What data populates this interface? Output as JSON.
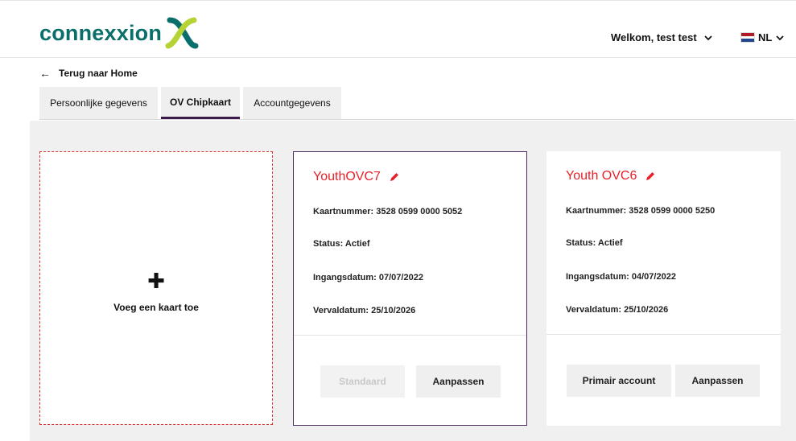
{
  "header": {
    "logo_text": "connexxion",
    "welcome": "Welkom, test test",
    "language": "NL",
    "colors": {
      "brand_teal": "#0a6e6b",
      "brand_lime": "#b5d334"
    }
  },
  "nav": {
    "back_label": "Terug naar Home"
  },
  "tabs": [
    {
      "label": "Persoonlijke gegevens",
      "active": false
    },
    {
      "label": "OV Chipkaart",
      "active": true
    },
    {
      "label": "Accountgegevens",
      "active": false
    }
  ],
  "add_card": {
    "icon": "plus-icon",
    "label": "Voeg een kaart toe"
  },
  "cards": [
    {
      "title": "YouthOVC7",
      "kaartnummer": "Kaartnummer: 3528 0599 0000 5052",
      "status": "Status: Actief",
      "ingangsdatum": "Ingangsdatum: 07/07/2022",
      "vervaldatum": "Vervaldatum: 25/10/2026",
      "btn_primary": "Standaard",
      "btn_secondary": "Aanpassen"
    },
    {
      "title": "Youth OVC6",
      "kaartnummer": "Kaartnummer: 3528 0599 0000 5250",
      "status": "Status: Actief",
      "ingangsdatum": "Ingangsdatum: 04/07/2022",
      "vervaldatum": "Vervaldatum: 25/10/2026",
      "btn_primary": "Primair account",
      "btn_secondary": "Aanpassen"
    }
  ],
  "colors": {
    "title_red": "#e8202a",
    "selected_border": "#4a2a5c",
    "dashed_border": "#d9342f"
  }
}
